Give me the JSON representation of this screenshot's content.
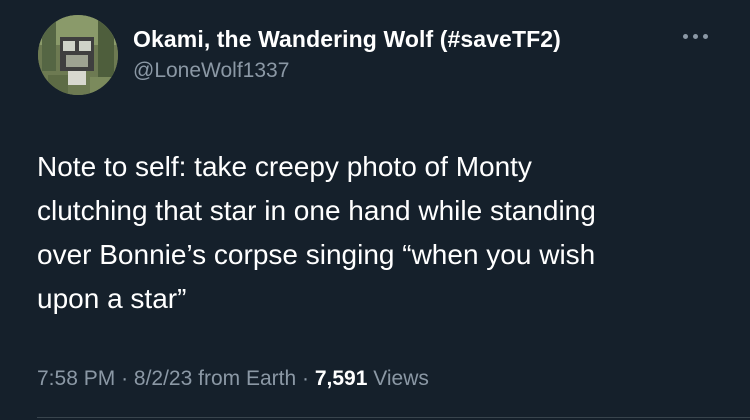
{
  "tweet": {
    "author": {
      "display_name": "Okami, the Wandering Wolf (#saveTF2)",
      "handle": "@LoneWolf1337",
      "avatar_icon": "profile-photo"
    },
    "more_icon": "more-options-icon",
    "text": "Note to self: take creepy photo of Monty\nclutching that star in one hand while standing\nover Bonnie’s corpse singing “when you wish\nupon a star”",
    "meta": {
      "time": "7:58 PM",
      "separator": "·",
      "date": "8/2/23",
      "source": "from Earth",
      "views_count": "7,591",
      "views_label": "Views"
    }
  },
  "colors": {
    "background": "#15202b",
    "primary_text": "#ffffff",
    "secondary_text": "#8b98a5",
    "divider": "#38444d"
  }
}
